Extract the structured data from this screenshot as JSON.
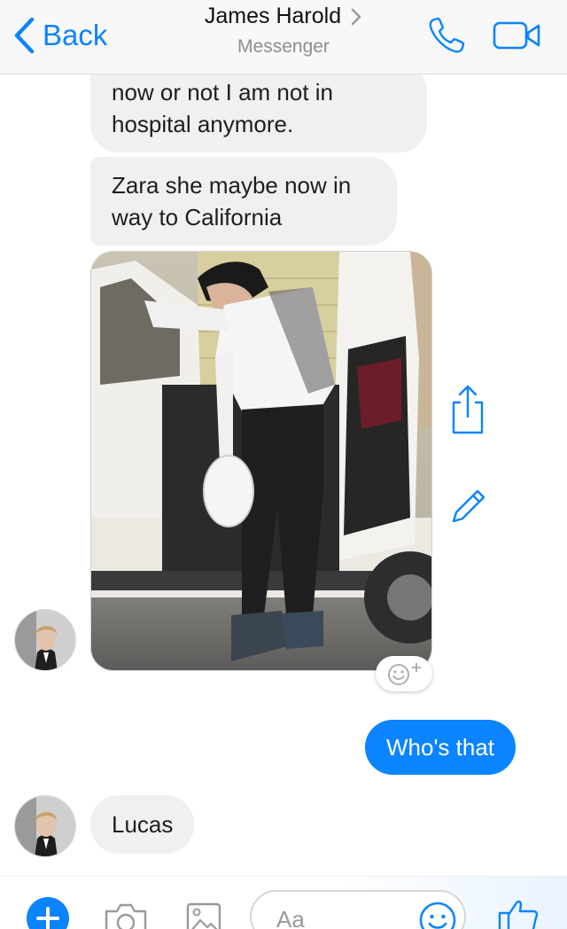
{
  "header": {
    "back_label": "Back",
    "title": "James Harold",
    "subtitle": "Messenger",
    "accent": "#0a84ff"
  },
  "messages": [
    {
      "from": "contact",
      "text_line1": "now or not I am not in",
      "text_line2": "hospital anymore."
    },
    {
      "from": "contact",
      "text_line1": "Zara she maybe now in",
      "text_line2": "way to California"
    },
    {
      "from": "contact",
      "type": "photo"
    },
    {
      "from": "me",
      "text": "Who's that"
    },
    {
      "from": "contact",
      "text": "Lucas"
    }
  ],
  "icons": {
    "call": "phone-icon",
    "video": "video-camera-icon",
    "share": "share-icon",
    "edit": "pencil-icon",
    "react": "add-reaction-icon",
    "add": "plus-icon",
    "camera": "camera-icon",
    "gallery": "image-icon",
    "emoji": "emoji-icon",
    "like": "thumbs-up-icon"
  },
  "composer": {
    "placeholder": "Aa"
  },
  "colors": {
    "incoming_bubble": "#f1f0f0",
    "outgoing_bubble": "#0a84ff"
  }
}
